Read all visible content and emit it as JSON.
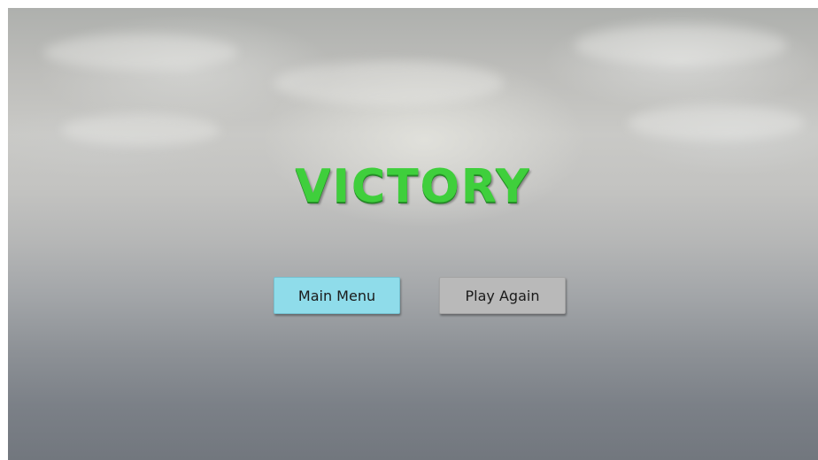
{
  "screen": {
    "title": "VICTORY",
    "title_color": "#3fcf3c"
  },
  "buttons": {
    "main_menu_label": "Main Menu",
    "main_menu_color": "#8fdcea",
    "play_again_label": "Play Again",
    "play_again_color": "#b9b9b9"
  }
}
